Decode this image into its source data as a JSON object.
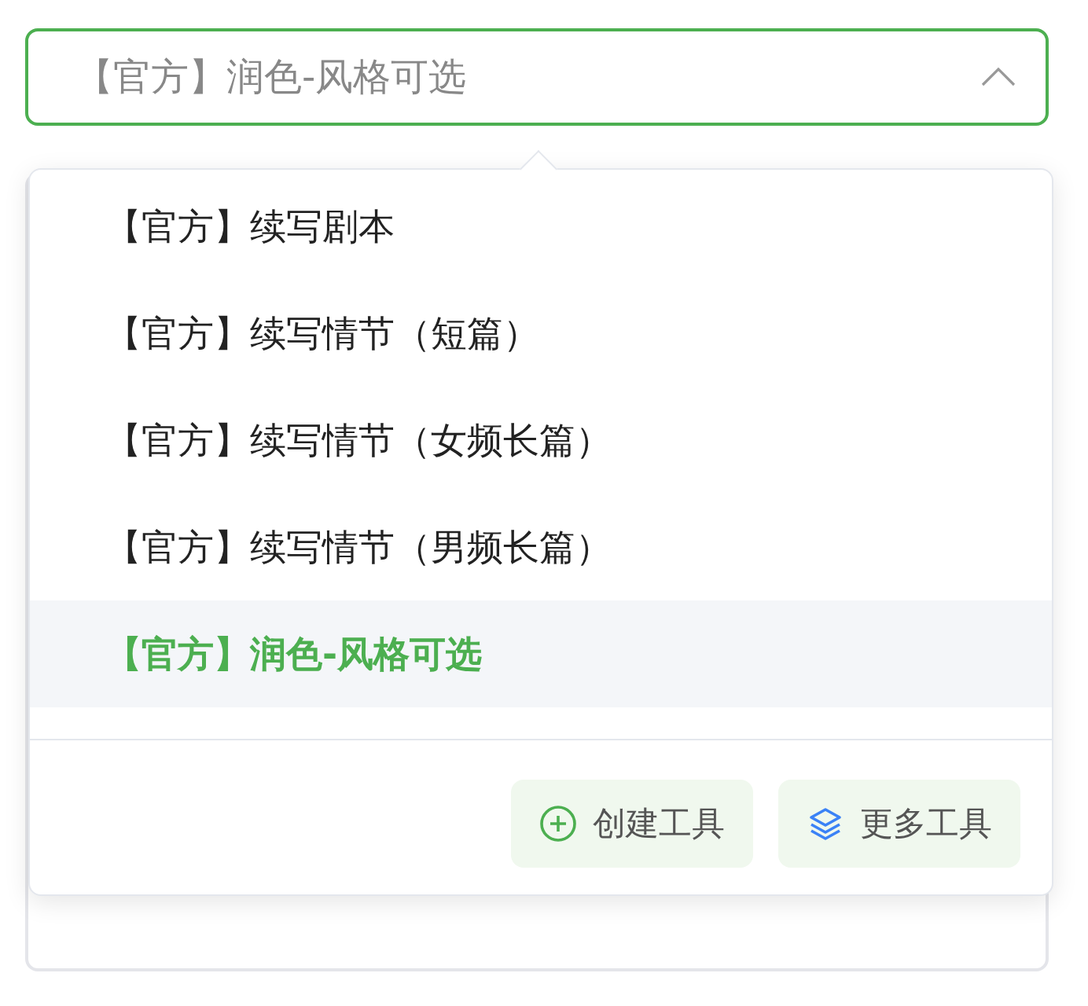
{
  "select": {
    "value": "【官方】润色-风格可选",
    "expanded": true
  },
  "options": [
    {
      "label": "【官方】续写剧本",
      "selected": false
    },
    {
      "label": "【官方】续写情节（短篇）",
      "selected": false
    },
    {
      "label": "【官方】续写情节（女频长篇）",
      "selected": false
    },
    {
      "label": "【官方】续写情节（男频长篇）",
      "selected": false
    },
    {
      "label": "【官方】润色-风格可选",
      "selected": true
    }
  ],
  "buttons": [
    {
      "kind": "create",
      "label": "创建工具"
    },
    {
      "kind": "more",
      "label": "更多工具"
    }
  ]
}
